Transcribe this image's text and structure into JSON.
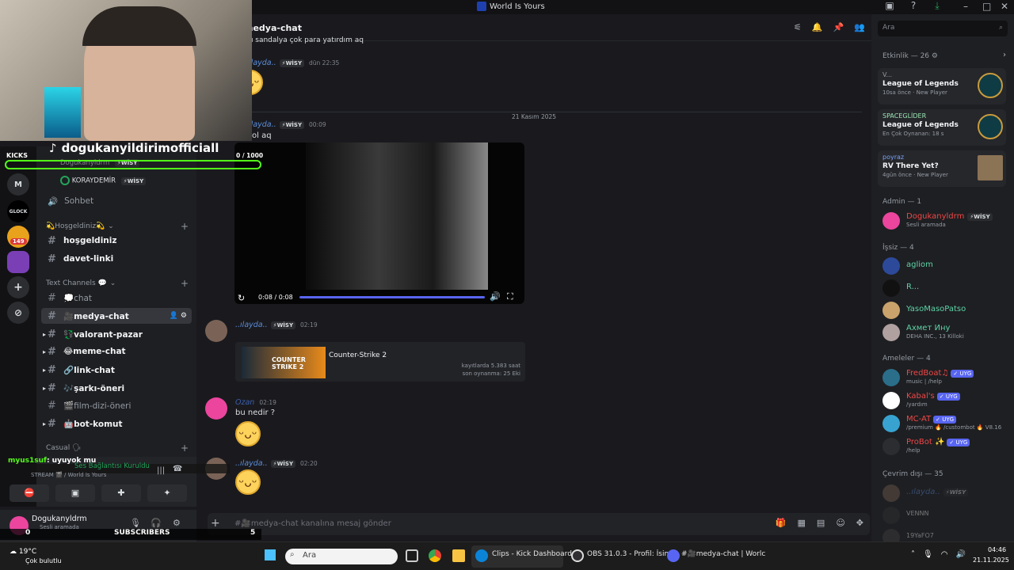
{
  "window": {
    "title": "World Is Yours"
  },
  "chat": {
    "channel_name": "medya-chat",
    "top_partial_text": "bu sandalya çok para yatırdım aq",
    "date_divider": "21 Kasım 2025",
    "messages": [
      {
        "user": "..ılayda..",
        "tag": "⚡WİSY",
        "time": "dün 22:35",
        "text": "",
        "emoji": "😄"
      },
      {
        "user": "..ılayda..",
        "tag": "⚡WİSY",
        "time": "00:09",
        "text": "ol aq"
      },
      {
        "user": "..ılayda..",
        "tag": "⚡WİSY",
        "time": "02:19",
        "text": ""
      },
      {
        "user": "Ozan",
        "tag": "",
        "time": "02:19",
        "text": "bu nedir ?",
        "emoji": "😄"
      },
      {
        "user": "..ılayda..",
        "tag": "⚡WİSY",
        "time": "02:20",
        "text": "",
        "emoji": "😄"
      }
    ],
    "video": {
      "time": "0:08 / 0:08"
    },
    "embed": {
      "title": "Counter-Strike 2",
      "line1": "kayıtlarda 5.383 saat",
      "line2": "son oynanma: 25 Eki",
      "logo": "COUNTER STRIKE 2"
    },
    "composer_placeholder": "#🎥medya-chat kanalına mesaj gönder"
  },
  "search": {
    "placeholder": "Ara"
  },
  "stream_overlay": {
    "tiktok_handle": "dogukanyildirimofficiall",
    "kicks_label": "KICKS",
    "counter": "0 / 1000",
    "chat_line_user": "myus1suf",
    "chat_line_text": ": uyuyok mu",
    "subscribers_label": "SUBSCRIBERS",
    "left_count": "0",
    "right_count": "5"
  },
  "sidebar": {
    "voice_users": [
      {
        "name": "Dogukanyldrm",
        "tag": "⚡WİSY"
      },
      {
        "name": "KORAYDEMİR",
        "tag": "⚡WİSY"
      }
    ],
    "sohbet": "Sohbet",
    "categories": [
      {
        "label": "💫Hoşgeldiniz💫"
      },
      {
        "label": "Text Channels 💬"
      },
      {
        "label": "Casual 🗣"
      }
    ],
    "channels": [
      "hoşgeldiniz",
      "davet-linki",
      "💭chat",
      "🎥medya-chat",
      "💱valorant-pazar",
      "😂meme-chat",
      "🔗link-chat",
      "🎶şarkı-öneri",
      "🎬film-dizi-öneri",
      "🤖bot-komut"
    ],
    "voice_status": "Ses Bağlantısı Kuruldu",
    "voice_sub": "STREAM 🎬 / World Is Yours",
    "user_name": "Dogukanyldrm",
    "user_status": "Sesli aramada",
    "badge_count": "149",
    "server_m": "M",
    "server_glock": "GLOCK"
  },
  "activity": {
    "header": "Etkinlik — 26",
    "cards": [
      {
        "user": "V...",
        "game": "League of Legends",
        "meta": "10sa önce",
        "extra": "New Player"
      },
      {
        "user": "SPACEGLİDER",
        "game": "League of Legends",
        "meta": "En Çok Oynanan: 18 s",
        "extra": ""
      },
      {
        "user": "poyraz",
        "game": "RV There Yet?",
        "meta": "4gün önce",
        "extra": "New Player"
      }
    ]
  },
  "members": {
    "admin_header": "Admin — 1",
    "admin": [
      {
        "name": "Dogukanyldrm",
        "tag": "⚡WİSY",
        "sub": "Sesli aramada"
      }
    ],
    "issiz_header": "İşsiz — 4",
    "issiz": [
      {
        "name": "agliom",
        "sub": ""
      },
      {
        "name": "R...",
        "sub": ""
      },
      {
        "name": "YasoMasoPatso",
        "sub": ""
      },
      {
        "name": "Ахмет Ину",
        "sub": "DEHA INC., 13 Killoki"
      }
    ],
    "ameleler_header": "Ameleler — 4",
    "ameleler": [
      {
        "name": "FredBoat♫",
        "badge": "✓ UYG",
        "sub": "music | /help"
      },
      {
        "name": "Kabal's",
        "badge": "✓ UYG",
        "sub": "/yardım"
      },
      {
        "name": "MC-AT",
        "badge": "✓ UYG",
        "sub": "/premium 🔥 /custombot 🔥 V8.16"
      },
      {
        "name": "ProBot ✨",
        "badge": "✓ UYG",
        "sub": "/help"
      }
    ],
    "offline_header": "Çevrim dışı — 35",
    "offline": [
      {
        "name": "..ılayda..",
        "tag": "⚡WİSY"
      },
      {
        "name": "VENNN"
      },
      {
        "name": "19YaFO7"
      }
    ]
  },
  "taskbar": {
    "weather_temp": "19°C",
    "weather_text": "Çok bulutlu",
    "search_placeholder": "Ara",
    "apps": [
      "Clips - Kick Dashboard ·",
      "OBS 31.0.3 - Profil: İsims",
      "#🎥medya-chat | Worlc"
    ],
    "time": "04:46",
    "date": "21.11.2025"
  },
  "colors": {
    "accent": "#5865f2",
    "kick_green": "#53fc18",
    "online": "#23a55a"
  }
}
